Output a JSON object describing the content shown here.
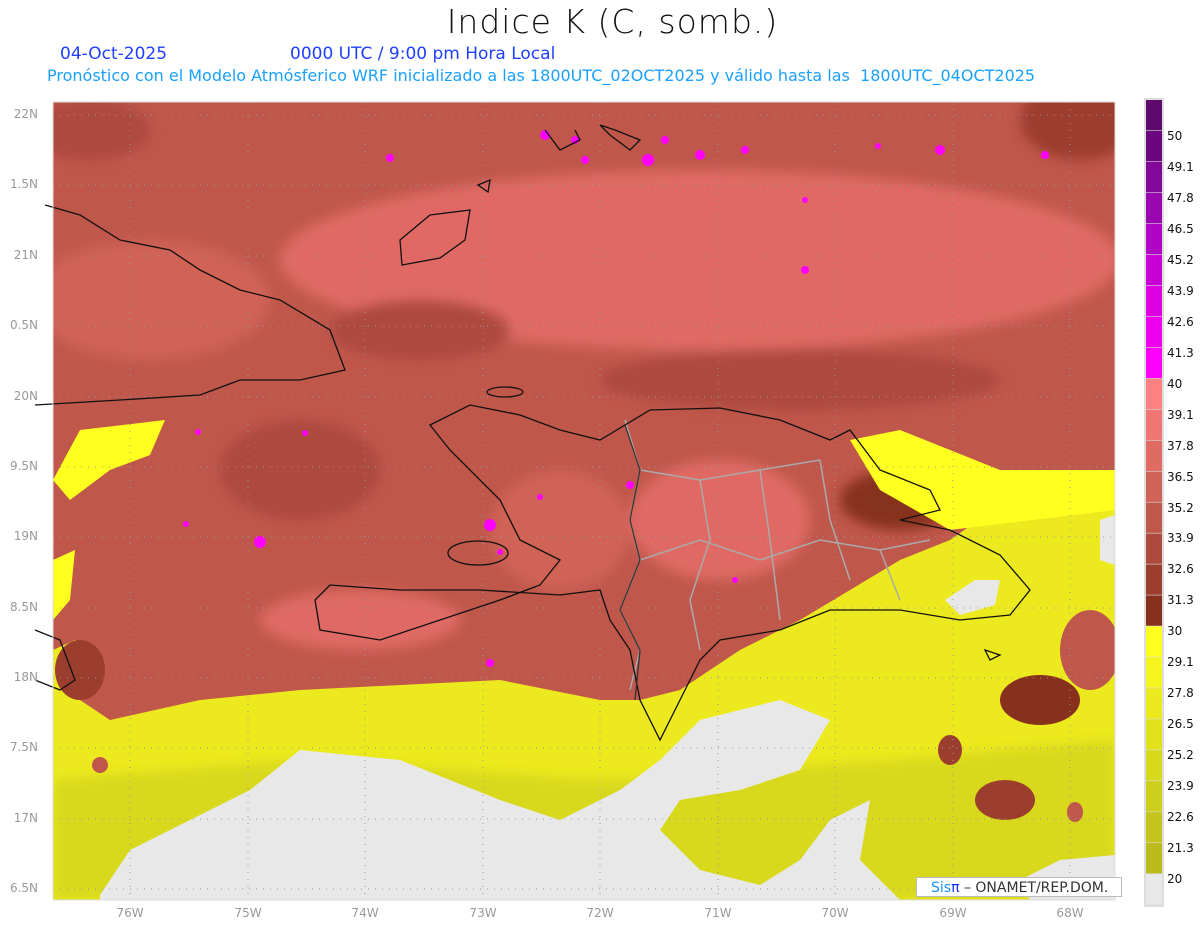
{
  "header": {
    "title": "Indice K (C, somb.)",
    "date": "04-Oct-2025",
    "time": "0000 UTC / 9:00 pm Hora Local",
    "description": "Pronóstico con el Modelo Atmósferico WRF inicializado a las 1800UTC_02OCT2025 y válido hasta las  1800UTC_04OCT2025"
  },
  "axes": {
    "lat_labels": [
      "22N",
      "1.5N",
      "21N",
      "0.5N",
      "20N",
      "9.5N",
      "19N",
      "8.5N",
      "18N",
      "7.5N",
      "17N",
      "6.5N"
    ],
    "lon_labels": [
      "76W",
      "75W",
      "74W",
      "73W",
      "72W",
      "71W",
      "70W",
      "69W",
      "68W"
    ]
  },
  "colorbar": {
    "labels": [
      "50",
      "49.1",
      "47.8",
      "46.5",
      "45.2",
      "43.9",
      "42.6",
      "41.3",
      "40",
      "39.1",
      "37.8",
      "36.5",
      "35.2",
      "33.9",
      "32.6",
      "31.3",
      "30",
      "29.1",
      "27.8",
      "26.5",
      "25.2",
      "23.9",
      "22.6",
      "21.3",
      "20"
    ],
    "colors": [
      "#5e0a6c",
      "#6c067e",
      "#82089a",
      "#9a06b0",
      "#b204c4",
      "#c802d6",
      "#dc00e2",
      "#ec00ee",
      "#ff00ff",
      "#ff8080",
      "#f07672",
      "#e06b63",
      "#d06256",
      "#c0574b",
      "#ad4a3d",
      "#9c3e2e",
      "#87301c",
      "#ffff20",
      "#f6f41e",
      "#ecea1e",
      "#e2e21c",
      "#d8d81c",
      "#cece1c",
      "#c4c41c",
      "#bbbb1c",
      "#e8e8e8"
    ]
  },
  "credit": {
    "brand_a": "Sis",
    "brand_b": "π",
    "text": " –  ONAMET/REP.DOM."
  }
}
